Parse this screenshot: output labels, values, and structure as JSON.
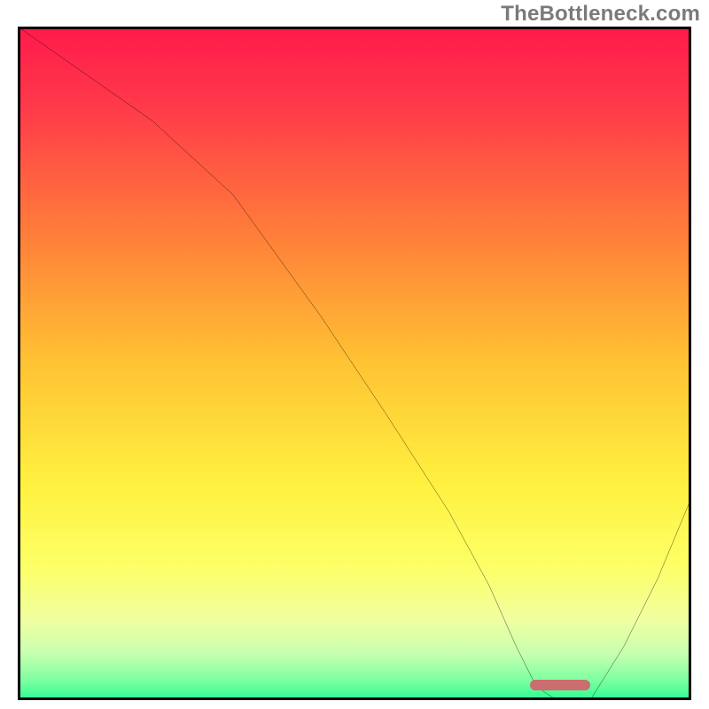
{
  "watermark": "TheBottleneck.com",
  "chart_data": {
    "type": "line",
    "title": "",
    "xlabel": "",
    "ylabel": "",
    "xlim": [
      0,
      100
    ],
    "ylim": [
      0,
      100
    ],
    "grid": false,
    "series": [
      {
        "name": "bottleneck-curve",
        "x": [
          0,
          10,
          20,
          32,
          45,
          55,
          64,
          70,
          74,
          77,
          80,
          85,
          90,
          95,
          100
        ],
        "y": [
          100,
          93,
          86,
          75,
          57,
          42,
          28,
          17,
          8,
          2,
          0,
          0,
          8,
          18,
          30
        ]
      }
    ],
    "optimal_zone": {
      "x_start": 76,
      "x_end": 85,
      "y": 1.5,
      "color": "#cc6d70"
    },
    "background_gradient_stops": [
      {
        "pos": 0.0,
        "color": "#ff1a4b"
      },
      {
        "pos": 0.12,
        "color": "#ff3a4a"
      },
      {
        "pos": 0.3,
        "color": "#ff7b3a"
      },
      {
        "pos": 0.5,
        "color": "#ffc333"
      },
      {
        "pos": 0.68,
        "color": "#fff140"
      },
      {
        "pos": 0.8,
        "color": "#fdff66"
      },
      {
        "pos": 0.88,
        "color": "#f1ffa0"
      },
      {
        "pos": 0.93,
        "color": "#c8ffb0"
      },
      {
        "pos": 0.97,
        "color": "#7effa0"
      },
      {
        "pos": 1.0,
        "color": "#2dfc94"
      }
    ]
  }
}
